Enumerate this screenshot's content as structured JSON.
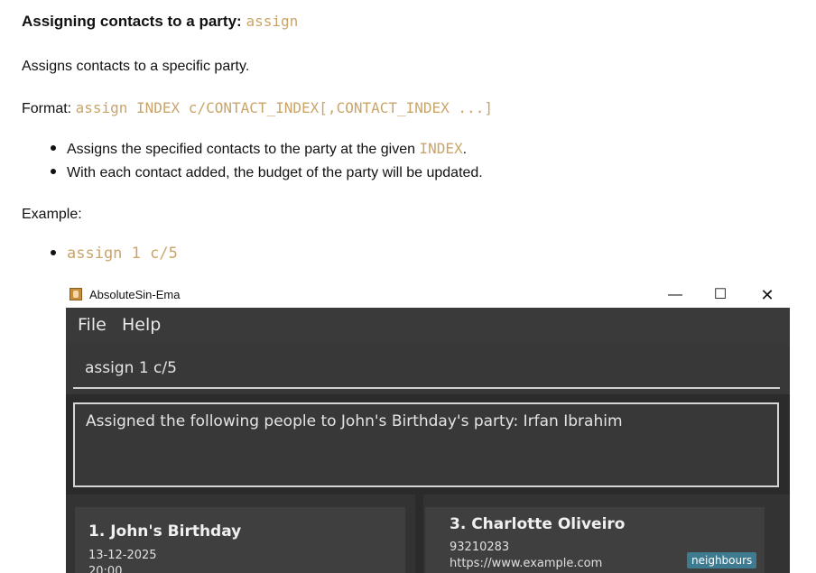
{
  "doc": {
    "heading": "Assigning contacts to a party:",
    "heading_code": "assign",
    "desc": "Assigns contacts to a specific party.",
    "format_label": "Format:",
    "format_code": "assign INDEX c/CONTACT_INDEX[,CONTACT_INDEX ...]",
    "bullets": [
      {
        "pre": "Assigns the specified contacts to the party at the given ",
        "code": "INDEX",
        "post": "."
      },
      {
        "text": "With each contact added, the budget of the party will be updated."
      }
    ],
    "example_label": "Example:",
    "example_code": "assign 1 c/5"
  },
  "app": {
    "title": "AbsoluteSin-Ema",
    "controls": {
      "minimize": "—",
      "maximize": "☐",
      "close": "✕"
    },
    "menu": [
      "File",
      "Help"
    ],
    "command": "assign 1 c/5",
    "result": "Assigned the following people to John's Birthday's party: Irfan Ibrahim",
    "party_card": {
      "name": "1. John's Birthday",
      "date": "13-12-2025",
      "time": "20:00"
    },
    "contact_card": {
      "name": "3. Charlotte Oliveiro",
      "phone": "93210283",
      "website": "https://www.example.com",
      "tag": "neighbours"
    }
  }
}
